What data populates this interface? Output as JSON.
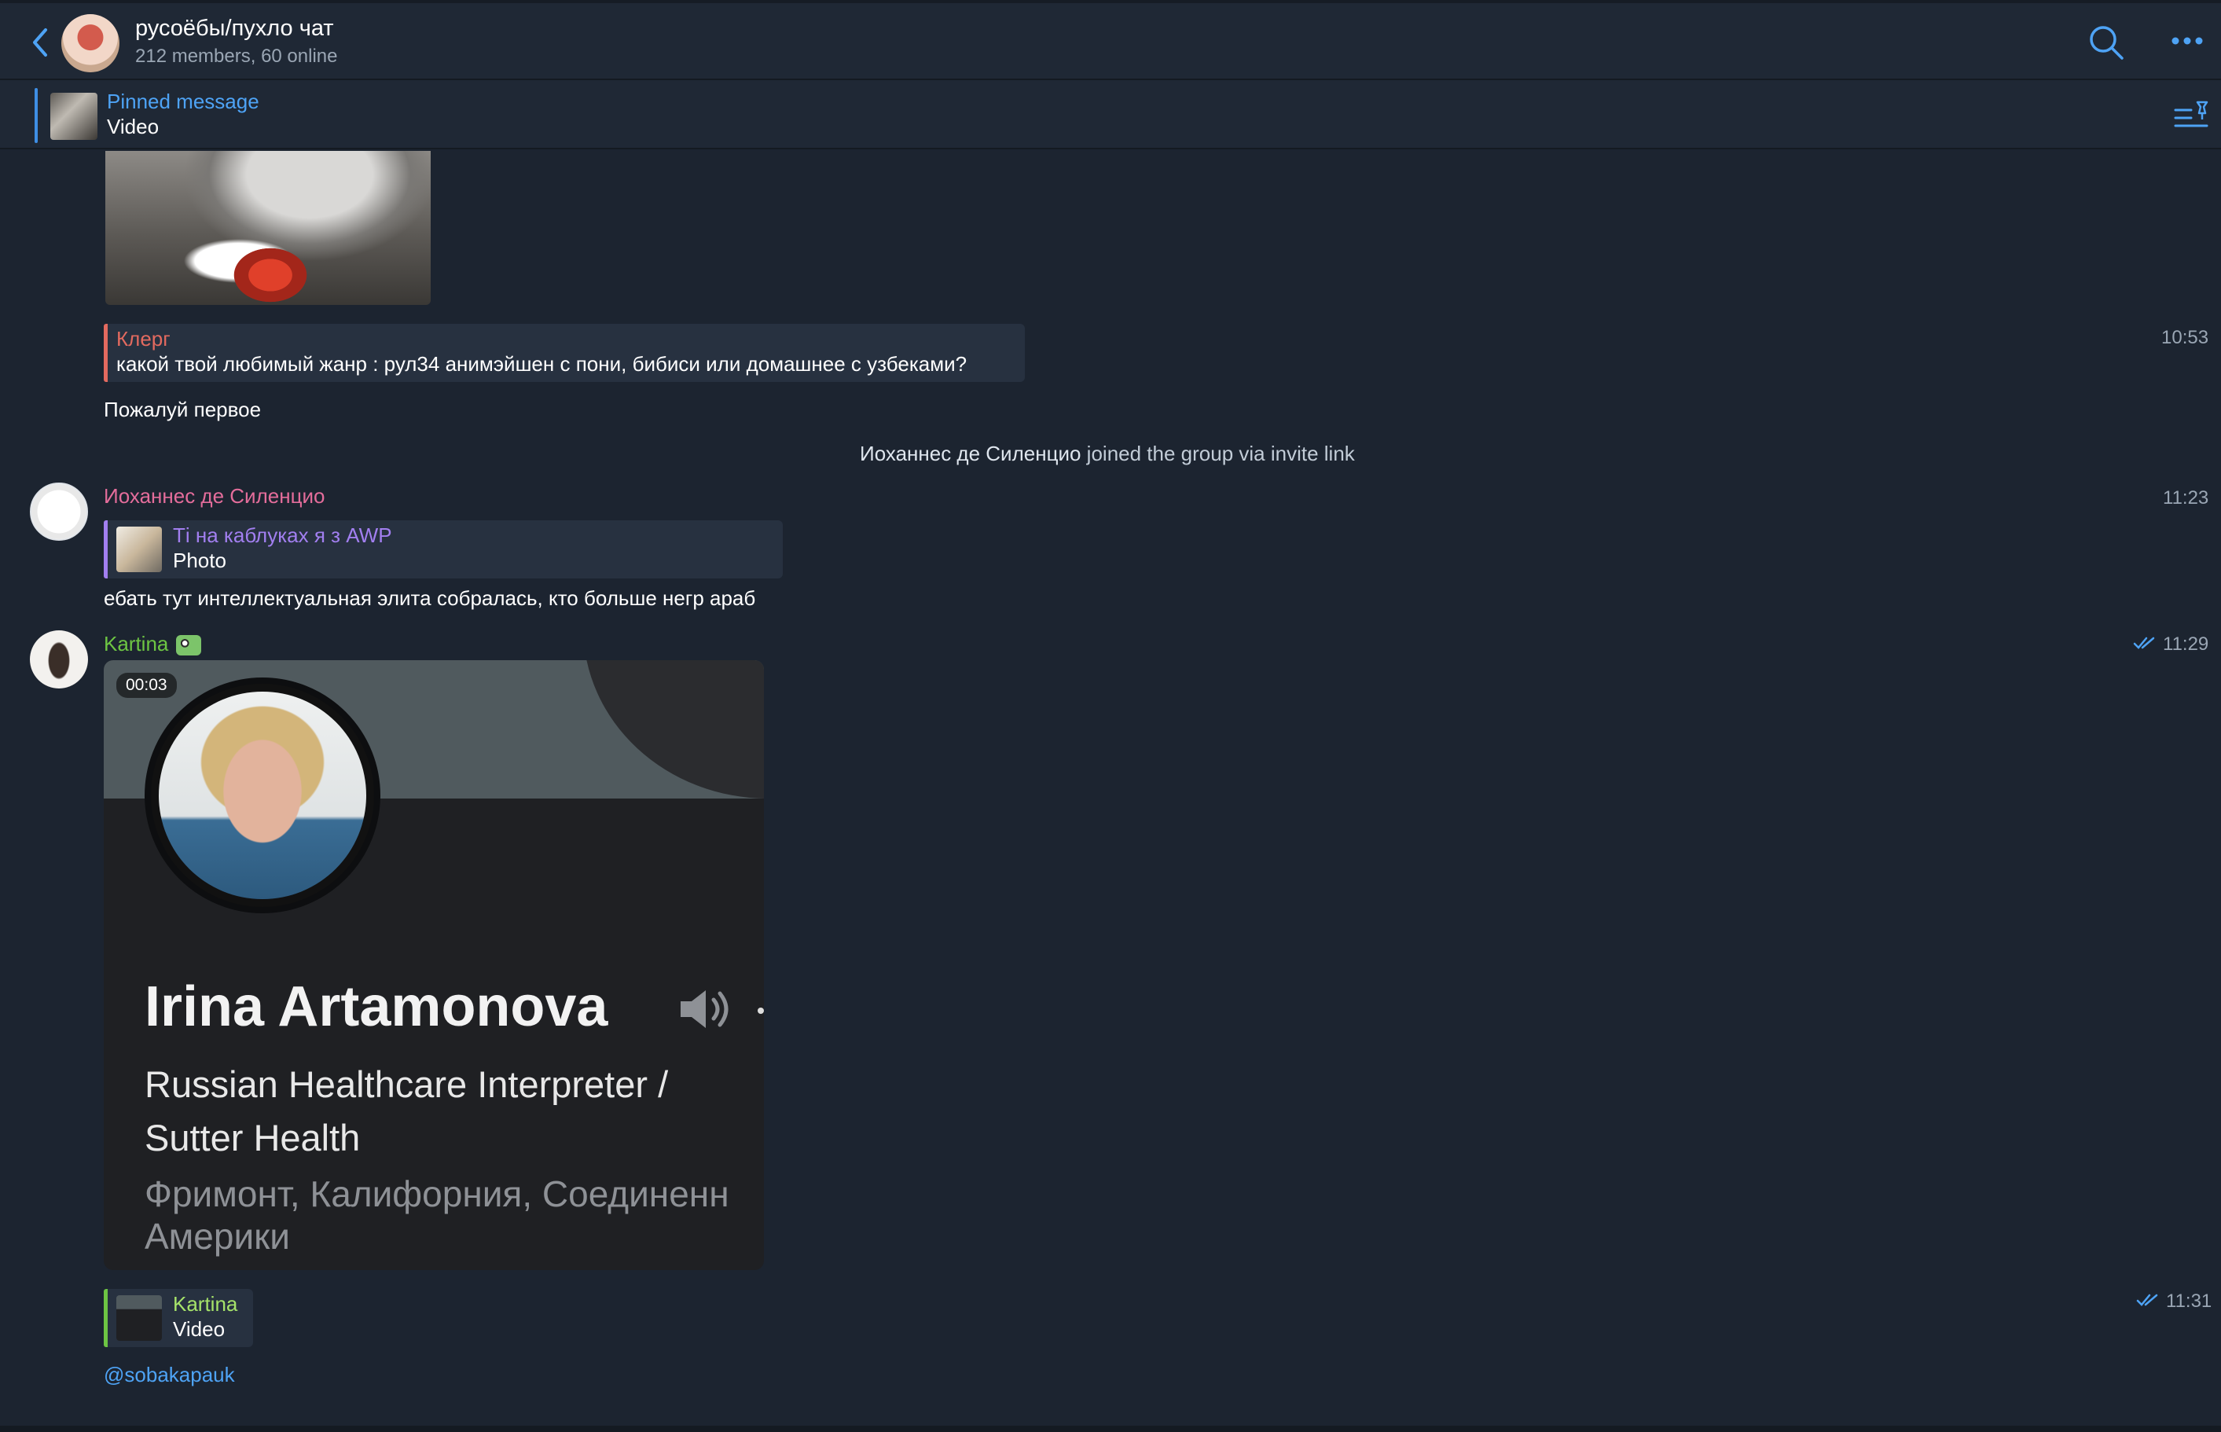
{
  "header": {
    "title": "русоёбы/пухло чат",
    "subtitle": "212 members, 60 online"
  },
  "pinned": {
    "label": "Pinned message",
    "value": "Video"
  },
  "messages": {
    "m1": {
      "reply_name": "Клерг",
      "reply_text": "какой твой любимый жанр : рул34 анимэйшен с пони, бибиси или домашнее с узбеками?",
      "time": "10:53",
      "text": "Пожалуй первое"
    },
    "system": {
      "name": "Иоханнес де Силенцио",
      "text": " joined the group via invite link"
    },
    "m2": {
      "author": "Иоханнес де Силенцио",
      "time": "11:23",
      "reply_name": "Ті на каблуках я з AWP",
      "reply_text": "Photo",
      "text": "ебать тут интеллектуальная элита собралась, кто больше негр араб"
    },
    "m3": {
      "author": "Kartina",
      "time": "11:29",
      "video_duration": "00:03",
      "card": {
        "name": "Irina Artamonova",
        "role": "Russian Healthcare Interpreter /",
        "company": "Sutter Health",
        "location_line1": "Фримонт, Калифорния, Соединенн",
        "location_line2": "Америки"
      }
    },
    "m4": {
      "reply_name": "Kartina",
      "reply_text": "Video",
      "time": "11:31",
      "text": "@sobakapauk"
    }
  },
  "colors": {
    "accent": "#4ea3f5",
    "background": "#1c2430",
    "name_red": "#e36a5f",
    "name_pink": "#e46d9b",
    "name_purple": "#a27ff0",
    "name_green": "#6dc543",
    "name_lightgreen": "#a6e36a"
  },
  "icons": [
    "back-chevron-icon",
    "search-icon",
    "more-icon",
    "pinned-list-icon",
    "double-check-icon",
    "speaker-icon",
    "frog-emoji-icon"
  ]
}
